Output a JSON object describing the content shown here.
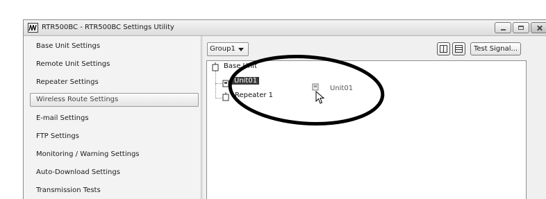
{
  "window": {
    "title": "RTR500BC - RTR500BC Settings Utility"
  },
  "sidebar": {
    "items": [
      {
        "label": "Base Unit Settings",
        "selected": false
      },
      {
        "label": "Remote Unit Settings",
        "selected": false
      },
      {
        "label": "Repeater Settings",
        "selected": false
      },
      {
        "label": "Wireless Route Settings",
        "selected": true
      },
      {
        "label": "E-mail Settings",
        "selected": false
      },
      {
        "label": "FTP Settings",
        "selected": false
      },
      {
        "label": "Monitoring / Warning Settings",
        "selected": false
      },
      {
        "label": "Auto-Download Settings",
        "selected": false
      },
      {
        "label": "Transmission Tests",
        "selected": false
      }
    ]
  },
  "toolbar": {
    "group_value": "Group1",
    "test_signal_label": "Test Signal..."
  },
  "tree": {
    "root_label": "Base Unit",
    "unit_label": "Unit01",
    "repeater_label": "Repeater 1",
    "drag_label": "Unit01"
  },
  "icons": {
    "app": "rtr500bc-app-icon",
    "minimize": "minimize-icon",
    "maximize": "maximize-icon",
    "close": "close-icon",
    "dropdown": "chevron-down-icon",
    "columns_layout": "columns-layout-icon",
    "rows_layout": "rows-layout-icon",
    "base_unit": "base-unit-icon",
    "remote_unit": "remote-unit-icon",
    "repeater": "repeater-icon",
    "cursor": "mouse-pointer-icon"
  },
  "colors": {
    "selected_node_bg": "#3a3a3a",
    "selected_node_text": "#ffffff"
  }
}
